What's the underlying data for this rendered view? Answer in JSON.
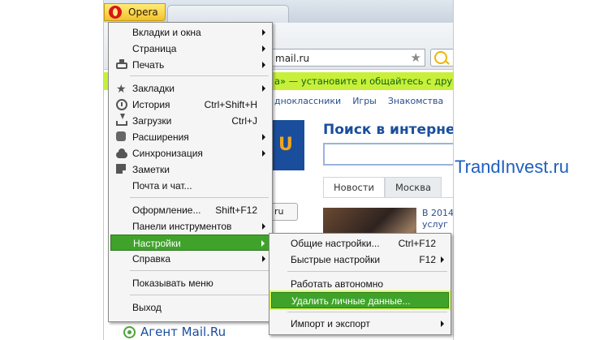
{
  "browser": {
    "opera_label": "Opera",
    "address": "mail.ru",
    "promo_text": "а» — установите и общайтесь с друз",
    "links": [
      "дноклассники",
      "Игры",
      "Знакомства"
    ],
    "logo_glyph": "U",
    "search_title": "Поиск в интернете",
    "news_tabs": [
      "Новости",
      "Москва"
    ],
    "region_value": "ru",
    "news_date": "В 2014",
    "news_snippet": "услуг",
    "agent_label": "Агент Mail.Ru"
  },
  "watermark": "TrandInvest.ru",
  "main_menu": {
    "items": [
      {
        "label": "Вкладки и окна",
        "submenu": true,
        "icon": ""
      },
      {
        "label": "Страница",
        "submenu": true,
        "icon": ""
      },
      {
        "label": "Печать",
        "submenu": true,
        "icon": "printer-icon"
      },
      {
        "label": "Закладки",
        "submenu": true,
        "icon": "star-icon"
      },
      {
        "label": "История",
        "shortcut": "Ctrl+Shift+H",
        "icon": "clock-icon"
      },
      {
        "label": "Загрузки",
        "shortcut": "Ctrl+J",
        "icon": "download-icon"
      },
      {
        "label": "Расширения",
        "submenu": true,
        "icon": "puzzle-icon"
      },
      {
        "label": "Синхронизация",
        "submenu": true,
        "icon": "cloud-icon"
      },
      {
        "label": "Заметки",
        "icon": "note-icon"
      },
      {
        "label": "Почта и чат...",
        "icon": ""
      },
      {
        "label": "Оформление...",
        "shortcut": "Shift+F12",
        "icon": ""
      },
      {
        "label": "Панели инструментов",
        "submenu": true,
        "icon": ""
      },
      {
        "label": "Настройки",
        "submenu": true,
        "active": true,
        "icon": ""
      },
      {
        "label": "Справка",
        "submenu": true,
        "icon": ""
      },
      {
        "label": "Показывать меню",
        "icon": ""
      },
      {
        "label": "Выход",
        "icon": ""
      }
    ]
  },
  "settings_submenu": {
    "items": [
      {
        "label": "Общие настройки...",
        "shortcut": "Ctrl+F12"
      },
      {
        "label": "Быстрые настройки",
        "shortcut": "F12",
        "submenu": true
      },
      {
        "label": "Работать автономно"
      },
      {
        "label": "Удалить личные данные...",
        "highlighted": true
      },
      {
        "label": "Импорт и экспорт",
        "submenu": true
      }
    ]
  },
  "colors": {
    "menu_highlight": "#3fa32b",
    "highlight_outline": "#d8ff40",
    "promo_bar": "#c8f03a",
    "watermark": "#1f5fbf"
  }
}
